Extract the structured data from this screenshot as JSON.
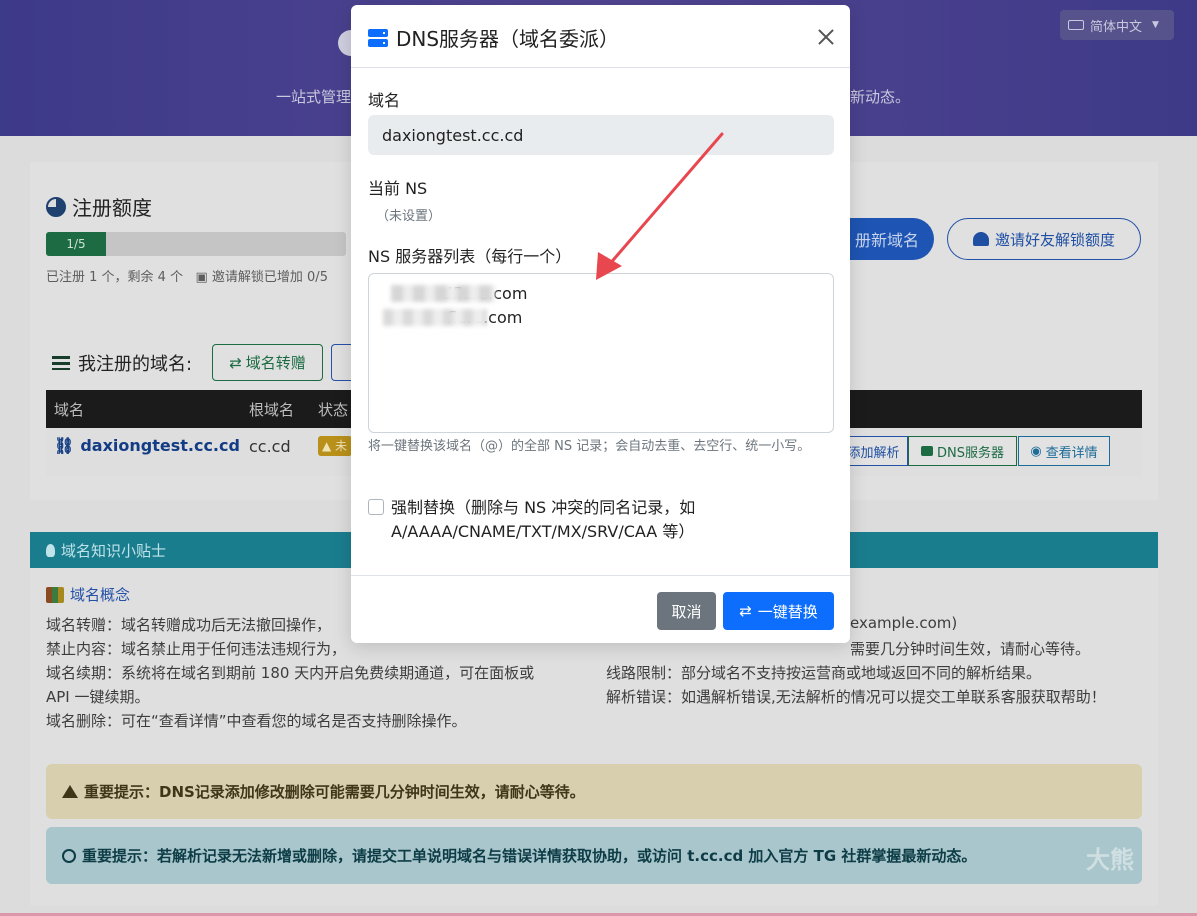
{
  "hero": {
    "subtitle_left": "一站式管理",
    "subtitle_right": "新动态。",
    "language": "简体中文"
  },
  "quota": {
    "title": "注册额度",
    "progress_label": "1/5",
    "progress_fraction": 0.2,
    "summary": "已注册 1 个，剩余 4 个",
    "invite_status": "邀请解锁已增加 0/5",
    "register_button": "册新域名",
    "invite_button": "邀请好友解锁额度"
  },
  "my_domains": {
    "title": "我注册的域名:",
    "transfer_button": "域名转赠",
    "columns": [
      "域名",
      "根域名",
      "状态"
    ],
    "row": {
      "domain": "daxiongtest.cc.cd",
      "root": "cc.cd",
      "status": "未",
      "actions": [
        "添加解析",
        "DNS服务器",
        "查看详情"
      ]
    }
  },
  "tips": {
    "header": "域名知识小贴士",
    "concept_link": "域名概念",
    "left_lines": [
      "域名转赠：域名转赠成功后无法撤回操作，",
      "禁止内容：域名禁止用于任何违法违规行为，",
      "域名续期：系统将在域名到期前 180 天内开启免费续期通道，可在面板或",
      "API 一键续期。",
      "域名删除：可在“查看详情”中查看您的域名是否支持删除操作。"
    ],
    "right_lines": [
      "example.com)",
      "需要几分钟时间生效，请耐心等待。",
      "线路限制：部分域名不支持按运营商或地域返回不同的解析结果。",
      "解析错误：如遇解析错误,无法解析的情况可以提交工单联系客服获取帮助！"
    ],
    "warning": "重要提示：DNS记录添加修改删除可能需要几分钟时间生效，请耐心等待。",
    "info": "重要提示：若解析记录无法新增或删除，请提交工单说明域名与错误详情获取协助，或访问 t.cc.cd 加入官方 TG 社群掌握最新动态。",
    "watermark": "大熊"
  },
  "modal": {
    "title": "DNS服务器（域名委派）",
    "domain_label": "域名",
    "domain_value": "daxiongtest.cc.cd",
    "current_ns_label": "当前 NS",
    "current_ns_value": "（未设置）",
    "ns_list_label": "NS 服务器列表（每行一个）",
    "ns_text": "dflare.com\nflare.com",
    "help": "将一键替换该域名（@）的全部 NS 记录；会自动去重、去空行、统一小写。",
    "force_label": "强制替换（删除与 NS 冲突的同名记录，如 A/AAAA/CNAME/TXT/MX/SRV/CAA 等）",
    "cancel": "取消",
    "replace": "一键替换"
  },
  "colors": {
    "primary": "#0d6efd",
    "secondary": "#6c757d",
    "arrow": "#e8474f"
  }
}
